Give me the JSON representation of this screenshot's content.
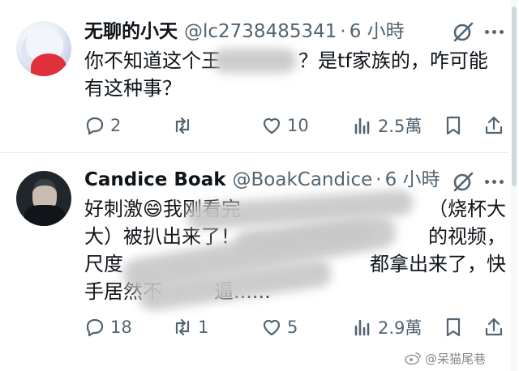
{
  "tweets": [
    {
      "name": "无聊的小天",
      "handle": "@lc2738485341",
      "time": "6 小時",
      "text": "你不知道这个王",
      "text_after_redaction": "？是tf家族的，咋可能有这种事？",
      "replies": "2",
      "retweets": "",
      "likes": "10",
      "views": "2.5萬"
    },
    {
      "name": "Candice Boak",
      "handle": "@BoakCandice",
      "time": "6 小時",
      "text": "好刺激😄我刚看完",
      "text_line2": "大）被扒出来了！",
      "text_visible_tail1": "（烧杯大",
      "text_visible_tail2": "的视频，",
      "text_line3_head": "尺度",
      "text_line3_tail": "都拿出来了，快",
      "text_line4_head": "手居然不",
      "text_line4_tail": "逼......",
      "replies": "18",
      "retweets": "1",
      "likes": "5",
      "views": "2.9萬"
    }
  ],
  "separator": "·",
  "watermark": "@呆猫尾巷",
  "icons": {
    "reply": "reply-icon",
    "retweet": "retweet-icon",
    "like": "like-icon",
    "views": "views-icon",
    "bookmark": "bookmark-icon",
    "share": "share-icon",
    "grok": "grok-icon",
    "more": "more-icon"
  },
  "colors": {
    "text": "#0f1419",
    "secondary": "#536471",
    "border": "#e6ebee"
  }
}
